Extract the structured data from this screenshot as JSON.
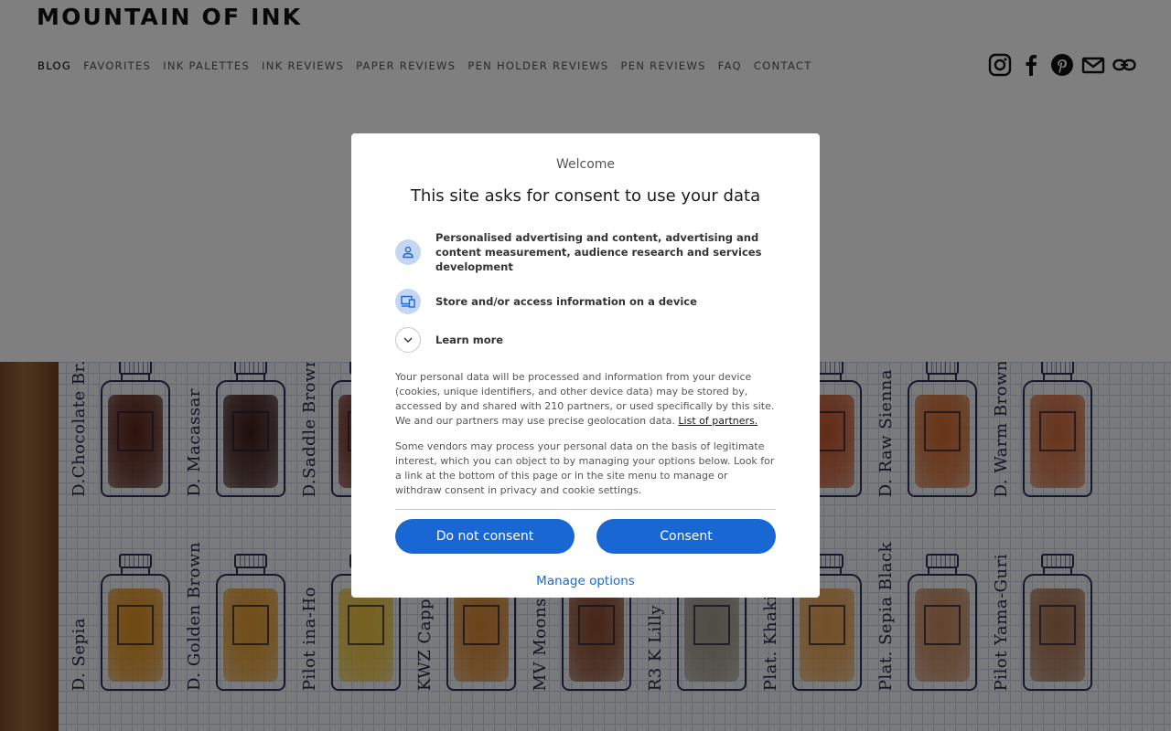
{
  "site": {
    "brand": "MOUNTAIN OF INK",
    "nav": [
      "BLOG",
      "FAVORITES",
      "INK PALETTES",
      "INK REVIEWS",
      "PAPER REVIEWS",
      "PEN HOLDER REVIEWS",
      "PEN REVIEWS",
      "FAQ",
      "CONTACT"
    ],
    "social_icons": [
      "instagram-icon",
      "facebook-icon",
      "pinterest-icon",
      "email-icon",
      "link-icon"
    ]
  },
  "hero": {
    "bottles": [
      {
        "name": "D.Chocolate Br.",
        "color": "#5b2417"
      },
      {
        "name": "D. Macassar",
        "color": "#3d1d19"
      },
      {
        "name": "D.Saddle Brown",
        "color": "#6e2a1e"
      },
      {
        "name": "",
        "color": "#b4432a"
      },
      {
        "name": "",
        "color": "#c24f2a"
      },
      {
        "name": "",
        "color": "#b2412b"
      },
      {
        "name": "",
        "color": "#c5582f"
      },
      {
        "name": "D. Raw Sienna",
        "color": "#d0692d"
      },
      {
        "name": "D. Warm Brown",
        "color": "#cf6a3a"
      },
      {
        "name": "D. Sepia",
        "color": "#e0901f"
      },
      {
        "name": "D. Golden Brown",
        "color": "#e39a2c"
      },
      {
        "name": "Pilot ina-Ho",
        "color": "#ecc23a"
      },
      {
        "name": "KWZ Cappuccino",
        "color": "#d6852e"
      },
      {
        "name": "MV Moonstone",
        "color": "#8b4a2c"
      },
      {
        "name": "R3 K Lilly",
        "color": "#9f978a"
      },
      {
        "name": "Plat. Khaki",
        "color": "#e5a04d"
      },
      {
        "name": "Plat. Sepia Black",
        "color": "#c4875c"
      },
      {
        "name": "Pilot Yama-Guri",
        "color": "#a8734e"
      }
    ]
  },
  "dialog": {
    "welcome": "Welcome",
    "title": "This site asks for consent to use your data",
    "purposes": [
      {
        "icon": "person-icon",
        "text": "Personalised advertising and content, advertising and content measurement, audience research and services development"
      },
      {
        "icon": "devices-icon",
        "text": "Store and/or access information on a device"
      }
    ],
    "learn_more": "Learn more",
    "paragraph1": "Your personal data will be processed and information from your device (cookies, unique identifiers, and other device data) may be stored by, accessed by and shared with 210 partners, or used specifically by this site. We and our partners may use precise geolocation data.",
    "partners_link": "List of partners.",
    "paragraph2": "Some vendors may process your personal data on the basis of legitimate interest, which you can object to by managing your options below. Look for a link at the bottom of this page or in the site menu to manage or withdraw consent in privacy and cookie settings.",
    "do_not_consent": "Do not consent",
    "consent": "Consent",
    "manage_options": "Manage options"
  },
  "colors": {
    "accent": "#1967d2",
    "overlay": "rgba(0,0,0,0.5)",
    "icon_bg": "#c4d6f2"
  }
}
